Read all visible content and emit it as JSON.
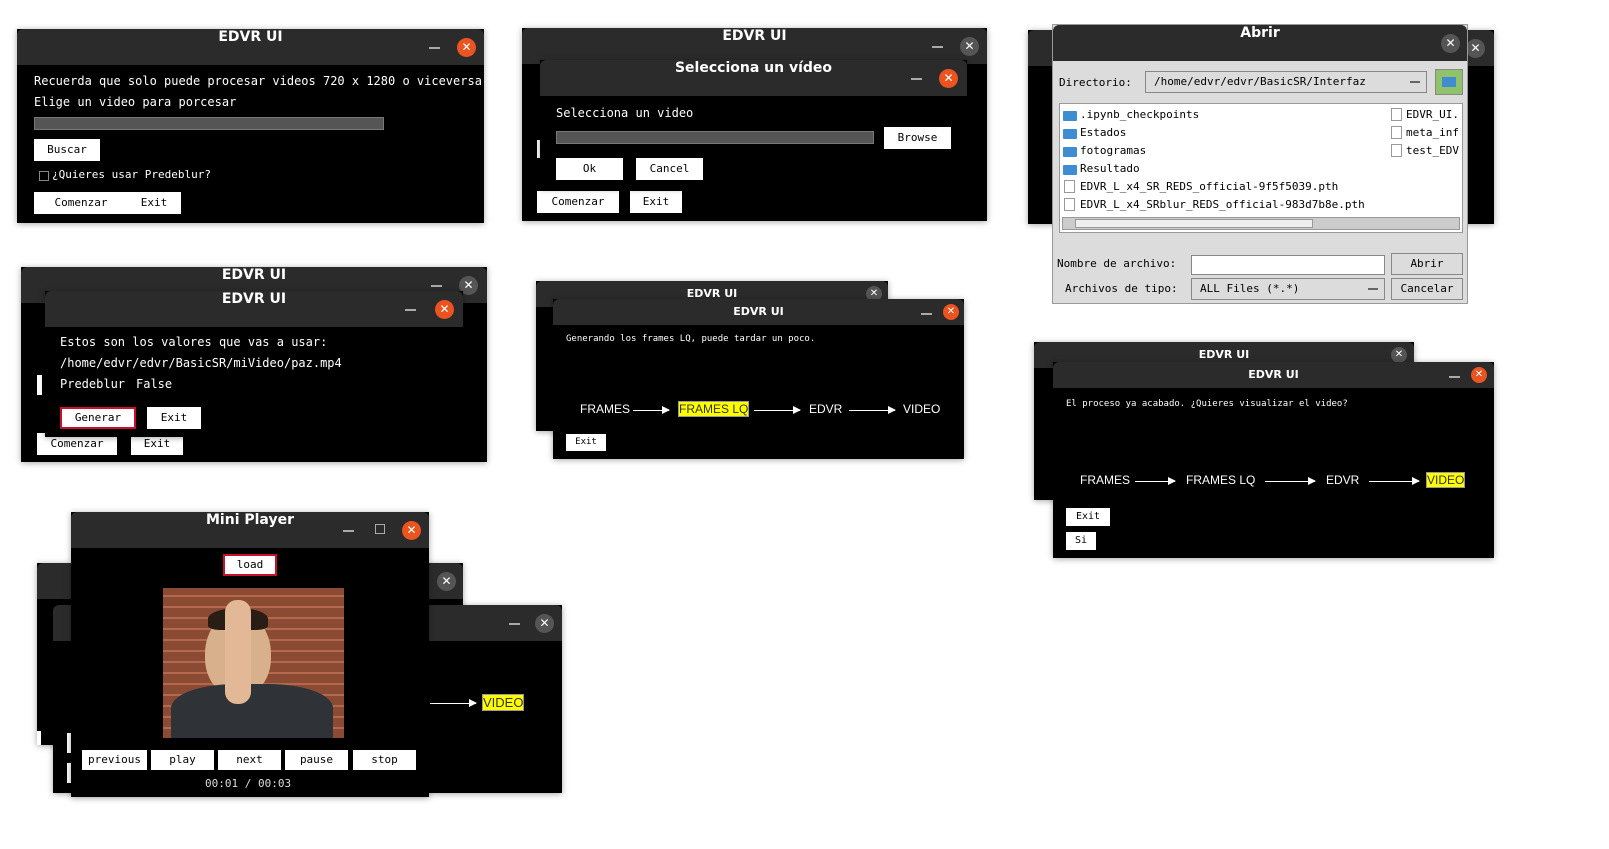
{
  "app_title": "EDVR UI",
  "win1": {
    "line1": "Recuerda que solo puede procesar videos 720 x 1280 o viceversa",
    "line2": "Elige un video para porcesar",
    "search_btn": "Buscar",
    "predeblur_label": "¿Quieres usar Predeblur?",
    "start_btn": "Comenzar",
    "exit_btn": "Exit"
  },
  "win2": {
    "dialog_title": "Selecciona un vídeo",
    "prompt": "Selecciona un video",
    "browse_btn": "Browse",
    "ok_btn": "Ok",
    "cancel_btn": "Cancel",
    "start_btn": "Comenzar",
    "exit_btn": "Exit"
  },
  "filedialog": {
    "title": "Abrir",
    "dir_label": "Directorio:",
    "dir_value": "/home/edvr/edvr/BasicSR/Interfaz",
    "folders": [
      ".ipynb_checkpoints",
      "Estados",
      "fotogramas",
      "Resultado"
    ],
    "files": [
      "EDVR_L_x4_SR_REDS_official-9f5f5039.pth",
      "EDVR_L_x4_SRblur_REDS_official-983d7b8e.pth"
    ],
    "right_files": [
      "EDVR_UI.",
      "meta_inf",
      "test_EDV"
    ],
    "filename_label": "Nombre de archivo:",
    "open_btn": "Abrir",
    "filetype_label": "Archivos de tipo:",
    "filetype_value": "ALL Files (*.*)",
    "cancel_btn": "Cancelar"
  },
  "win3": {
    "line1": "Estos son los valores que vas a usar:",
    "path": "/home/edvr/edvr/BasicSR/miVideo/paz.mp4",
    "predeblur_label": "Predeblur",
    "predeblur_value": "False",
    "generate_btn": "Generar",
    "exit_btn": "Exit",
    "start_btn": "Comenzar",
    "exit_btn_bg": "Exit"
  },
  "win4": {
    "message": "Generando los frames LQ, puede tardar un poco.",
    "exit_btn": "Exit"
  },
  "win5": {
    "message": "El proceso ya acabado. ¿Quieres visualizar el video?",
    "exit_btn": "Exit",
    "yes_btn": "Si"
  },
  "flow": {
    "s1": "FRAMES",
    "s2": "FRAMES LQ",
    "s3": "EDVR",
    "s4": "VIDEO"
  },
  "player": {
    "title": "Mini Player",
    "load_btn": "load",
    "controls": [
      "previous",
      "play",
      "next",
      "pause",
      "stop"
    ],
    "time": "00:01 / 00:03",
    "bg_video_label": "VIDEO"
  },
  "colors": {
    "accent": "#e95420",
    "highlight": "#ffff00",
    "titlebar": "#2b2b2b",
    "alert_border": "#c8102e"
  }
}
